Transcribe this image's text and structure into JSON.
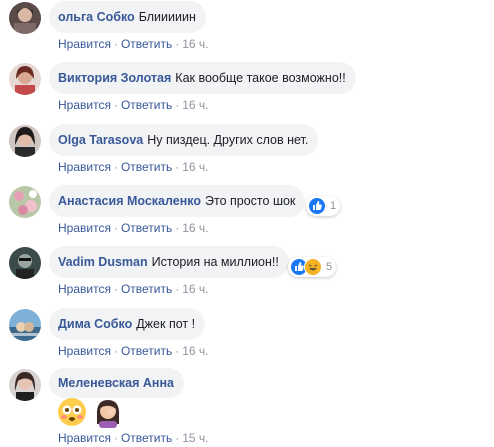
{
  "actions": {
    "like": "Нравится",
    "reply": "Ответить",
    "separator": "·"
  },
  "comments": [
    {
      "author": "ольга Собко",
      "text": "Блииииин",
      "time": "16 ч."
    },
    {
      "author": "Виктория Золотая",
      "text": "Как вообще такое возможно!!",
      "time": "16 ч."
    },
    {
      "author": "Olga Tarasova",
      "text": "Ну пиздец. Других слов нет.",
      "time": "16 ч."
    },
    {
      "author": "Анастасия Москаленко",
      "text": "Это просто шок",
      "time": "16 ч.",
      "reactions": {
        "types": [
          "like"
        ],
        "count": "1"
      }
    },
    {
      "author": "Vadim Dusman",
      "text": "История на миллион!!",
      "time": "16 ч.",
      "reactions": {
        "types": [
          "like",
          "haha"
        ],
        "count": "5"
      }
    },
    {
      "author": "Дима Собко",
      "text": "Джек пот !",
      "time": "16 ч."
    },
    {
      "author": "Меленевская Анна",
      "text": "",
      "time": "15 ч.",
      "emojis": [
        "flushed-face-icon",
        "woman-facepalming-icon"
      ]
    }
  ],
  "colors": {
    "author": "#385898",
    "bubble": "#f2f3f5",
    "meta": "#90949c",
    "like": "#1877f2",
    "haha": "#f7b125"
  }
}
